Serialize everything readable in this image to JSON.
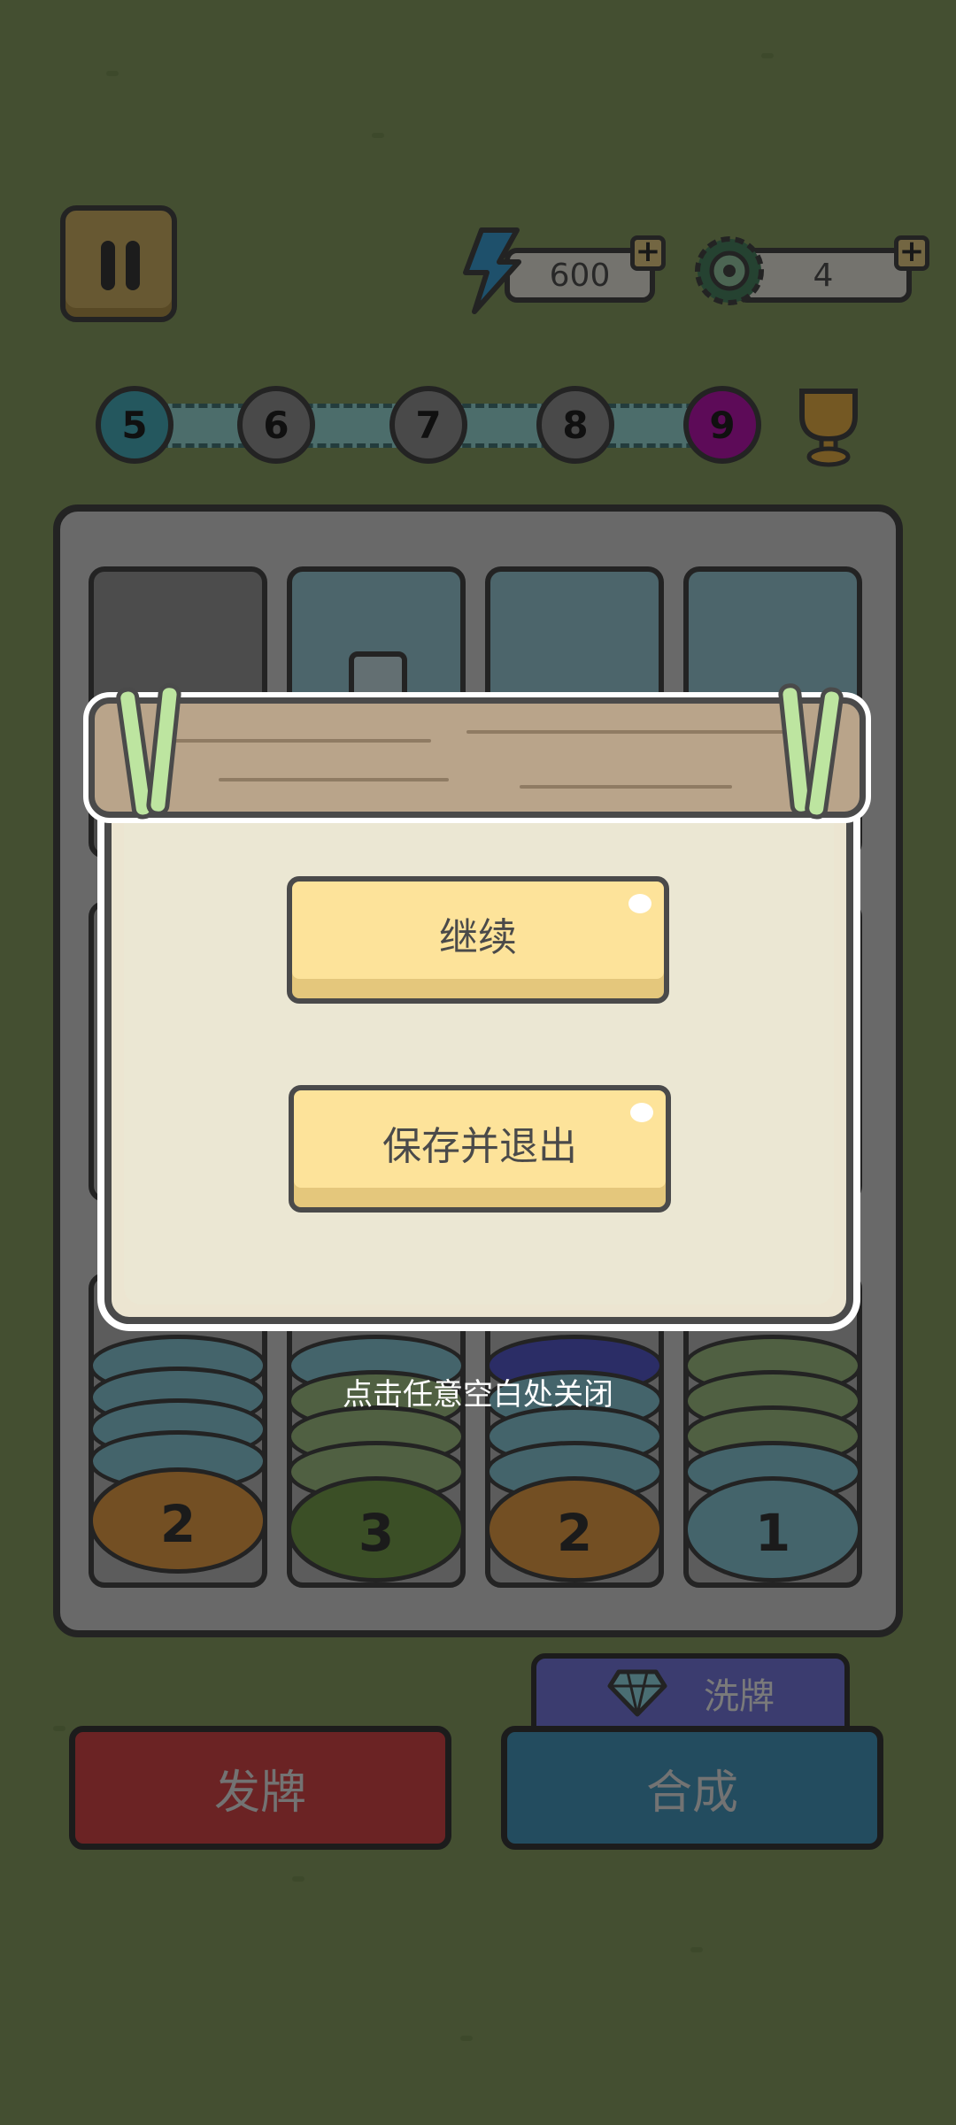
{
  "resources": {
    "energy_value": "600",
    "gear_value": "4",
    "energy_icon": "lightning-icon",
    "gear_icon": "gear-icon"
  },
  "levels": [
    {
      "label": "5",
      "color": "#4bb6c4"
    },
    {
      "label": "6",
      "color": "#9a9a9a"
    },
    {
      "label": "7",
      "color": "#9a9a9a"
    },
    {
      "label": "8",
      "color": "#9a9a9a"
    },
    {
      "label": "9",
      "color": "#c218b8"
    }
  ],
  "stacks": [
    {
      "number": "2",
      "top_color": "#f0a64a",
      "body_color": "#8fd1e0"
    },
    {
      "number": "3",
      "top_color": "#7ba650",
      "body_color": "#a7c98a"
    },
    {
      "number": "2",
      "top_color": "#f0a64a",
      "body_color": "#8fd1e0"
    },
    {
      "number": "1",
      "top_color": "#8fd1e0",
      "body_color": "#a7c98a"
    }
  ],
  "buttons": {
    "deal": "发牌",
    "merge": "合成",
    "shuffle": "洗牌"
  },
  "dialog": {
    "continue": "继续",
    "save_exit": "保存并退出",
    "close_hint": "点击任意空白处关闭"
  },
  "colors": {
    "deal_button": "#e0494d",
    "merge_button": "#4a9fc7",
    "shuffle_tab": "#7b7de8"
  }
}
